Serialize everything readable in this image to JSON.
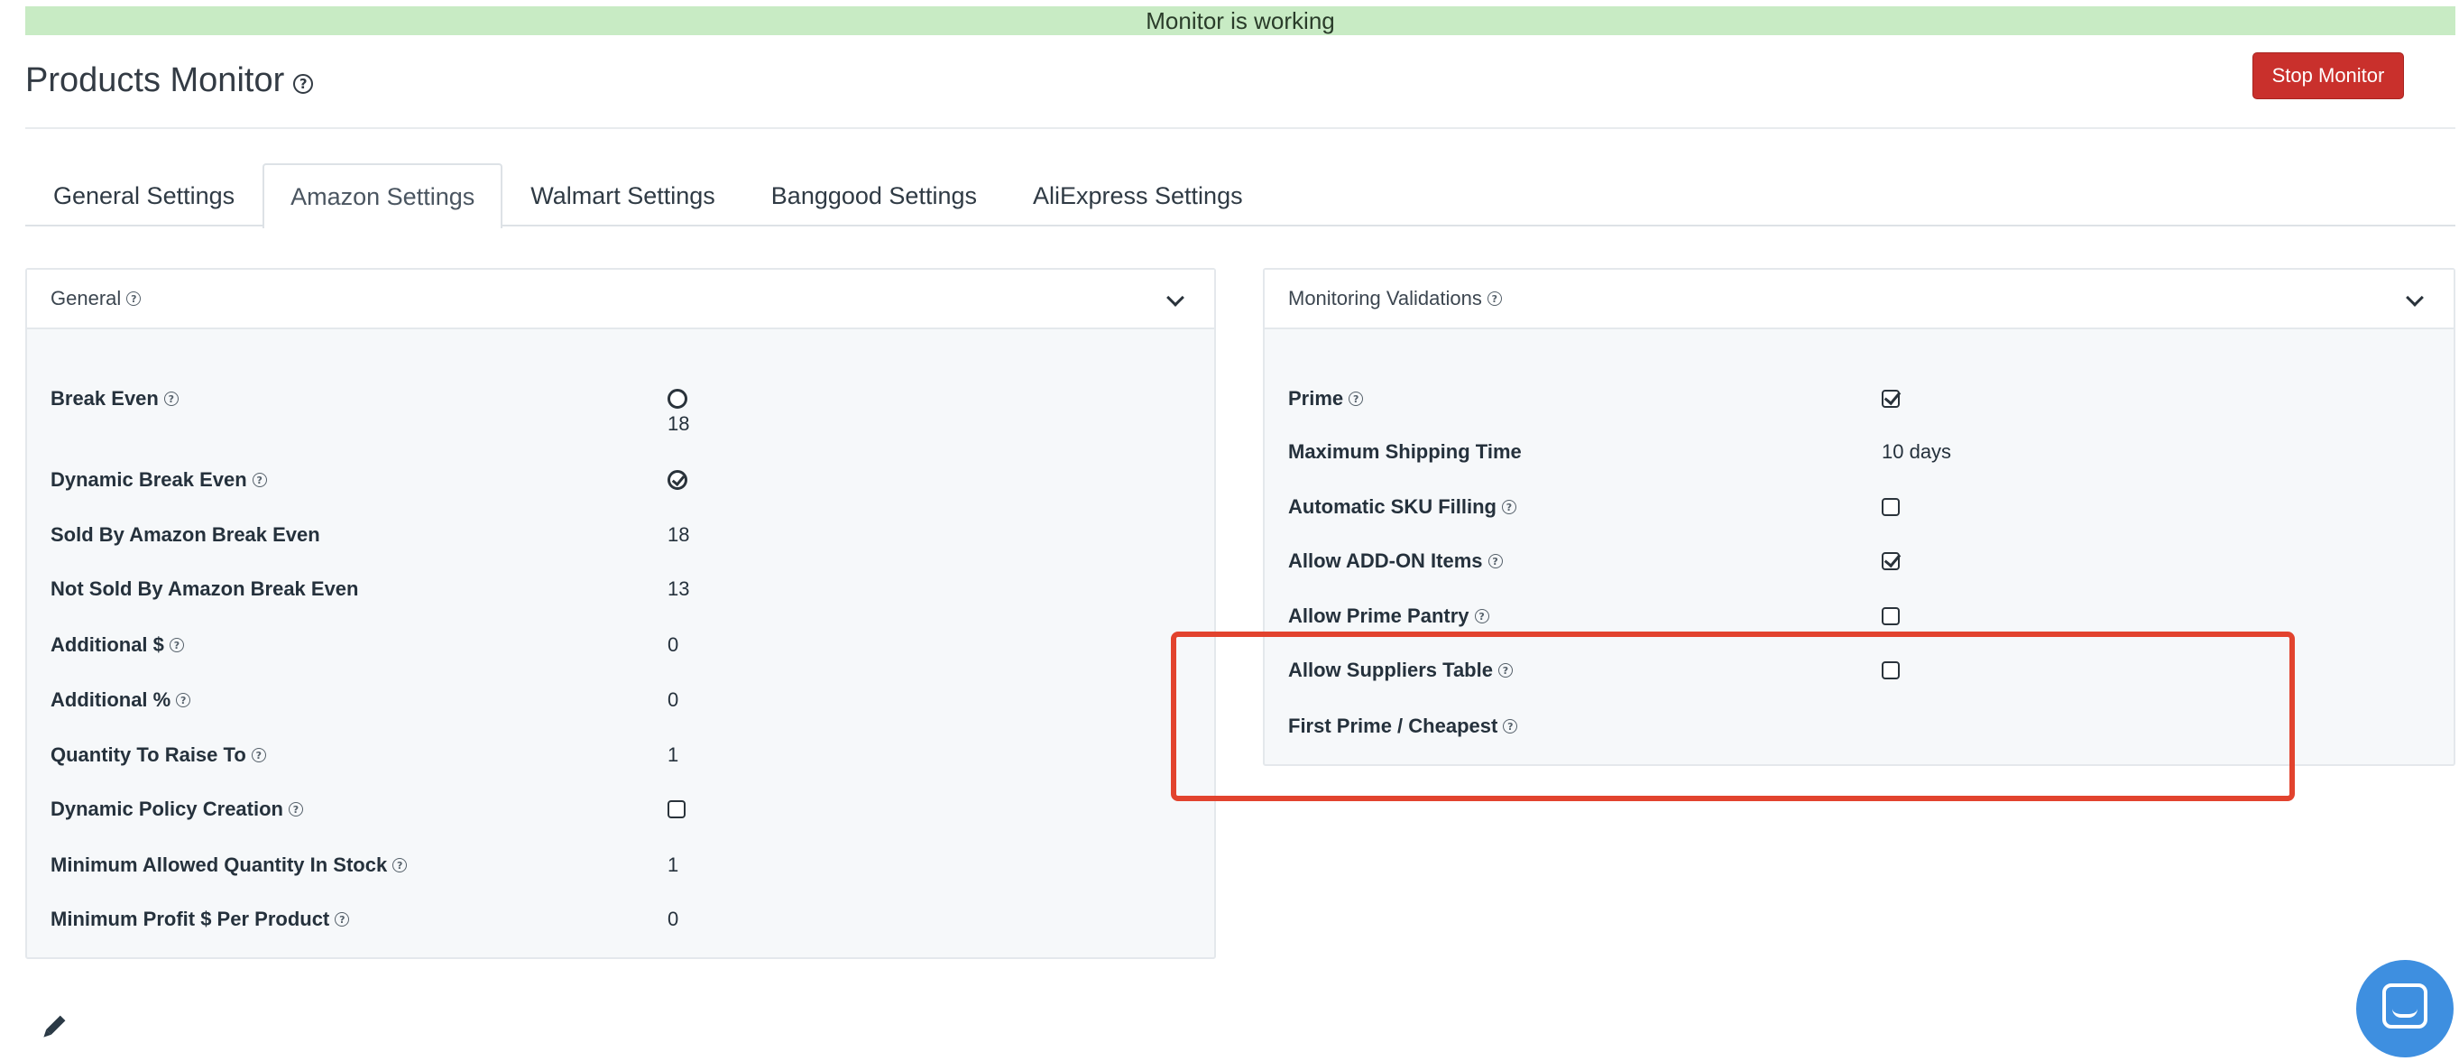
{
  "status": {
    "text": "Monitor is working",
    "color": "#c8ebc4"
  },
  "header": {
    "title": "Products Monitor",
    "help_icon": "question-circle-icon",
    "stop_button_label": "Stop Monitor",
    "stop_button_color": "#c9302c"
  },
  "tabs": [
    {
      "label": "General Settings",
      "active": false
    },
    {
      "label": "Amazon Settings",
      "active": true
    },
    {
      "label": "Walmart Settings",
      "active": false
    },
    {
      "label": "Banggood Settings",
      "active": false
    },
    {
      "label": "AliExpress Settings",
      "active": false
    }
  ],
  "general_panel": {
    "title": "General",
    "rows": [
      {
        "label": "Break Even",
        "help": true,
        "control": "radio",
        "checked": false,
        "value": "18"
      },
      {
        "label": "Dynamic Break Even",
        "help": true,
        "control": "radio",
        "checked": true
      },
      {
        "label": "Sold By Amazon Break Even",
        "help": false,
        "value": "18"
      },
      {
        "label": "Not Sold By Amazon Break Even",
        "help": false,
        "value": "13"
      },
      {
        "label": "Additional $",
        "help": true,
        "value": "0"
      },
      {
        "label": "Additional %",
        "help": true,
        "value": "0"
      },
      {
        "label": "Quantity To Raise To",
        "help": true,
        "value": "1"
      },
      {
        "label": "Dynamic Policy Creation",
        "help": true,
        "control": "checkbox",
        "checked": false
      },
      {
        "label": "Minimum Allowed Quantity In Stock",
        "help": true,
        "value": "1"
      },
      {
        "label": "Minimum Profit $ Per Product",
        "help": true,
        "value": "0"
      }
    ]
  },
  "validations_panel": {
    "title": "Monitoring Validations",
    "rows": [
      {
        "label": "Prime",
        "help": true,
        "control": "checkbox",
        "checked": true
      },
      {
        "label": "Maximum Shipping Time",
        "help": false,
        "value": "10 days"
      },
      {
        "label": "Automatic SKU Filling",
        "help": true,
        "control": "checkbox",
        "checked": false
      },
      {
        "label": "Allow ADD-ON Items",
        "help": true,
        "control": "checkbox",
        "checked": true
      },
      {
        "label": "Allow Prime Pantry",
        "help": true,
        "control": "checkbox",
        "checked": false
      },
      {
        "label": "Allow Suppliers Table",
        "help": true,
        "control": "checkbox",
        "checked": false
      },
      {
        "label": "First Prime / Cheapest",
        "help": true
      }
    ]
  },
  "highlight_color": "#e2432e",
  "icons": {
    "edit": "pencil-icon",
    "chat": "chat-bubble-icon",
    "collapse": "chevron-down-icon"
  }
}
